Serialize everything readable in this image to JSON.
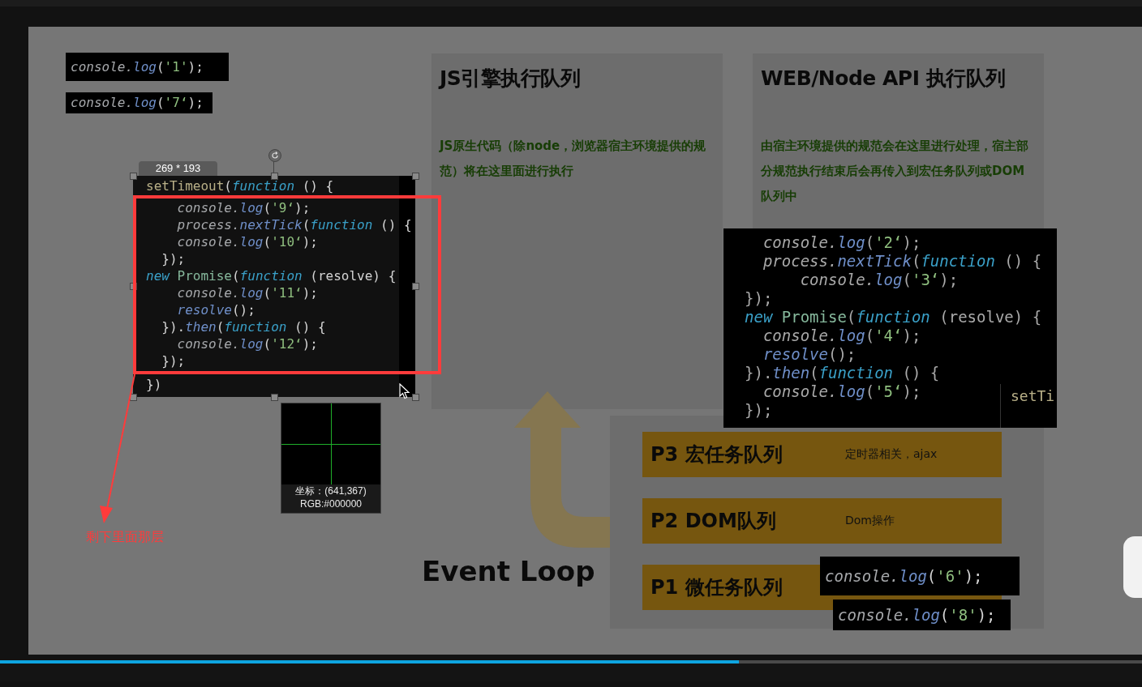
{
  "slide": {
    "title": "Event Loop",
    "panels": [
      {
        "heading": "JS引擎执行队列",
        "text": "JS原生代码（除node，浏览器宿主环境提供的规范）将在这里面进行执行"
      },
      {
        "heading": "WEB/Node API 执行队列",
        "text": "由宿主环境提供的规范会在这里进行处理，宿主部分规范执行结束后会再传入到宏任务队列或DOM队列中"
      }
    ],
    "queues": [
      {
        "label": "P3 宏任务队列",
        "note": "定时器相关，ajax"
      },
      {
        "label": "P2 DOM队列",
        "note": "Dom操作"
      },
      {
        "label": "P1 微任务队列"
      }
    ],
    "code_window": {
      "lines": [
        [
          {
            "kind": "i",
            "text": "  console."
          },
          {
            "kind": "m",
            "text": "log"
          },
          {
            "kind": "p",
            "text": "("
          },
          {
            "kind": "s",
            "text": "'2‘"
          },
          {
            "kind": "p",
            "text": ");"
          }
        ],
        [
          {
            "kind": "i",
            "text": "  process."
          },
          {
            "kind": "m",
            "text": "nextTick"
          },
          {
            "kind": "p",
            "text": "("
          },
          {
            "kind": "k",
            "text": "function"
          },
          {
            "kind": "p",
            "text": " () {"
          }
        ],
        [
          {
            "kind": "i",
            "text": "      console."
          },
          {
            "kind": "m",
            "text": "log"
          },
          {
            "kind": "p",
            "text": "("
          },
          {
            "kind": "s",
            "text": "'3‘"
          },
          {
            "kind": "p",
            "text": ");"
          }
        ],
        [
          {
            "kind": "p",
            "text": "});"
          }
        ],
        [
          {
            "kind": "k",
            "text": "new"
          },
          {
            "kind": "c",
            "text": " Promise"
          },
          {
            "kind": "p",
            "text": "("
          },
          {
            "kind": "k",
            "text": "function"
          },
          {
            "kind": "p",
            "text": " (resolve) {"
          }
        ],
        [
          {
            "kind": "i",
            "text": "  console."
          },
          {
            "kind": "m",
            "text": "log"
          },
          {
            "kind": "p",
            "text": "("
          },
          {
            "kind": "s",
            "text": "'4‘"
          },
          {
            "kind": "p",
            "text": ");"
          }
        ],
        [
          {
            "kind": "m",
            "text": "  resolve"
          },
          {
            "kind": "p",
            "text": "();"
          }
        ],
        [
          {
            "kind": "p",
            "text": "})."
          },
          {
            "kind": "m",
            "text": "then"
          },
          {
            "kind": "p",
            "text": "("
          },
          {
            "kind": "k",
            "text": "function"
          },
          {
            "kind": "p",
            "text": " () {"
          }
        ],
        [
          {
            "kind": "i",
            "text": "  console."
          },
          {
            "kind": "m",
            "text": "log"
          },
          {
            "kind": "p",
            "text": "("
          },
          {
            "kind": "s",
            "text": "'5‘"
          },
          {
            "kind": "p",
            "text": ");"
          }
        ],
        [
          {
            "kind": "p",
            "text": "});"
          }
        ]
      ],
      "cut_text": "setTi"
    },
    "snippets": [
      [
        [
          {
            "kind": "i",
            "text": "console."
          },
          {
            "kind": "m",
            "text": "log"
          },
          {
            "kind": "p",
            "text": "("
          },
          {
            "kind": "s",
            "text": "'1'"
          },
          {
            "kind": "p",
            "text": ");"
          }
        ]
      ],
      [
        [
          {
            "kind": "i",
            "text": "console."
          },
          {
            "kind": "m",
            "text": "log"
          },
          {
            "kind": "p",
            "text": "("
          },
          {
            "kind": "s",
            "text": "'7‘"
          },
          {
            "kind": "p",
            "text": ");"
          }
        ]
      ],
      [
        [
          {
            "kind": "i",
            "text": "console."
          },
          {
            "kind": "m",
            "text": "log"
          },
          {
            "kind": "p",
            "text": "("
          },
          {
            "kind": "s",
            "text": "'6'"
          },
          {
            "kind": "p",
            "text": ");"
          }
        ]
      ],
      [
        [
          {
            "kind": "i",
            "text": "console."
          },
          {
            "kind": "m",
            "text": "log"
          },
          {
            "kind": "p",
            "text": "("
          },
          {
            "kind": "s",
            "text": "'8'"
          },
          {
            "kind": "p",
            "text": ");"
          }
        ]
      ]
    ]
  },
  "capture_tool": {
    "size": "269 * 193",
    "code_lines": [
      [
        {
          "kind": "f",
          "text": "setTimeout"
        },
        {
          "kind": "p",
          "text": "("
        },
        {
          "kind": "k",
          "text": "function"
        },
        {
          "kind": "p",
          "text": " () {"
        }
      ],
      [
        {
          "kind": "i",
          "text": "    console."
        },
        {
          "kind": "m",
          "text": "log"
        },
        {
          "kind": "p",
          "text": "("
        },
        {
          "kind": "s",
          "text": "'9‘"
        },
        {
          "kind": "p",
          "text": ");"
        }
      ],
      [
        {
          "kind": "i",
          "text": "    process."
        },
        {
          "kind": "m",
          "text": "nextTick"
        },
        {
          "kind": "p",
          "text": "("
        },
        {
          "kind": "k",
          "text": "function"
        },
        {
          "kind": "p",
          "text": " () {"
        }
      ],
      [
        {
          "kind": "i",
          "text": "    console."
        },
        {
          "kind": "m",
          "text": "log"
        },
        {
          "kind": "p",
          "text": "("
        },
        {
          "kind": "s",
          "text": "'10‘"
        },
        {
          "kind": "p",
          "text": ");"
        }
      ],
      [
        {
          "kind": "p",
          "text": "  });"
        }
      ],
      [
        {
          "kind": "k",
          "text": "new"
        },
        {
          "kind": "c",
          "text": " Promise"
        },
        {
          "kind": "p",
          "text": "("
        },
        {
          "kind": "k",
          "text": "function"
        },
        {
          "kind": "p",
          "text": " (resolve) {"
        }
      ],
      [
        {
          "kind": "i",
          "text": "    console."
        },
        {
          "kind": "m",
          "text": "log"
        },
        {
          "kind": "p",
          "text": "("
        },
        {
          "kind": "s",
          "text": "'11‘"
        },
        {
          "kind": "p",
          "text": ");"
        }
      ],
      [
        {
          "kind": "m",
          "text": "    resolve"
        },
        {
          "kind": "p",
          "text": "();"
        }
      ],
      [
        {
          "kind": "p",
          "text": "  })."
        },
        {
          "kind": "m",
          "text": "then"
        },
        {
          "kind": "p",
          "text": "("
        },
        {
          "kind": "k",
          "text": "function"
        },
        {
          "kind": "p",
          "text": " () {"
        }
      ],
      [
        {
          "kind": "i",
          "text": "    console."
        },
        {
          "kind": "m",
          "text": "log"
        },
        {
          "kind": "p",
          "text": "("
        },
        {
          "kind": "s",
          "text": "'12‘"
        },
        {
          "kind": "p",
          "text": ");"
        }
      ],
      [
        {
          "kind": "p",
          "text": "  });"
        }
      ],
      [
        {
          "kind": "p",
          "text": "})"
        }
      ]
    ],
    "magnifier": {
      "coords": "坐标：(641,367)",
      "pixel_reading": "RGB:#000000"
    },
    "annotation": "剩下里面那层"
  },
  "player": {
    "progress": {
      "level": 0.647
    }
  }
}
